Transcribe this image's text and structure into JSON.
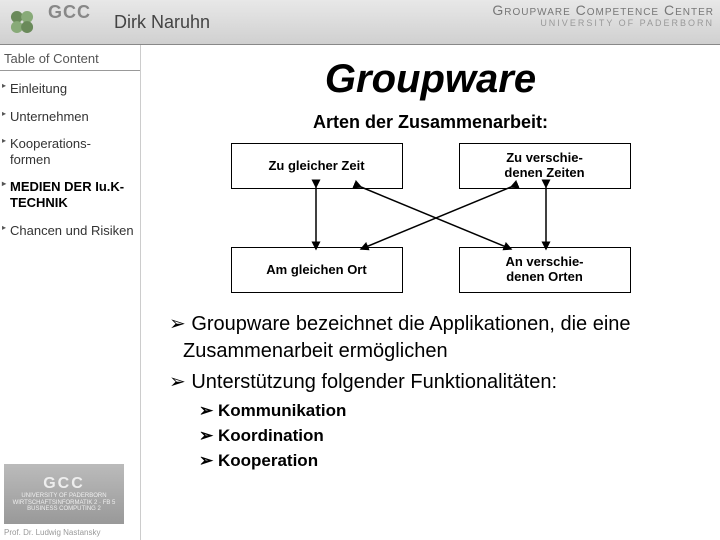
{
  "header": {
    "logo_text": "GCC",
    "author": "Dirk Naruhn",
    "right_line1": "Groupware Competence Center",
    "right_line2": "UNIVERSITY OF PADERBORN"
  },
  "sidebar": {
    "toc_title": "Table of Content",
    "items": [
      {
        "label": "Einleitung",
        "active": false
      },
      {
        "label": "Unternehmen",
        "active": false
      },
      {
        "label": "Kooperations-\nformen",
        "active": false
      },
      {
        "label": "MEDIEN DER Iu.K-TECHNIK",
        "active": true
      },
      {
        "label": "Chancen und Risiken",
        "active": false
      }
    ],
    "footer_logo_main": "GCC",
    "footer_logo_sub": "UNIVERSITY OF PADERBORN\nWIRTSCHAFTSINFORMATIK 2 · FB 5\nBUSINESS COMPUTING 2",
    "footer_credit": "Prof. Dr. Ludwig Nastansky"
  },
  "content": {
    "title": "Groupware",
    "subtitle": "Arten der Zusammenarbeit:",
    "boxes": {
      "top_left": "Zu gleicher Zeit",
      "top_right": "Zu verschie-\ndenen Zeiten",
      "bottom_left": "Am gleichen Ort",
      "bottom_right": "An verschie-\ndenen Orten"
    },
    "bullets_lvl1": [
      "Groupware bezeichnet die Applikationen, die eine Zusammenarbeit ermöglichen",
      "Unterstützung folgender Funktionalitäten:"
    ],
    "bullets_lvl2": [
      "Kommunikation",
      "Koordination",
      "Kooperation"
    ]
  }
}
